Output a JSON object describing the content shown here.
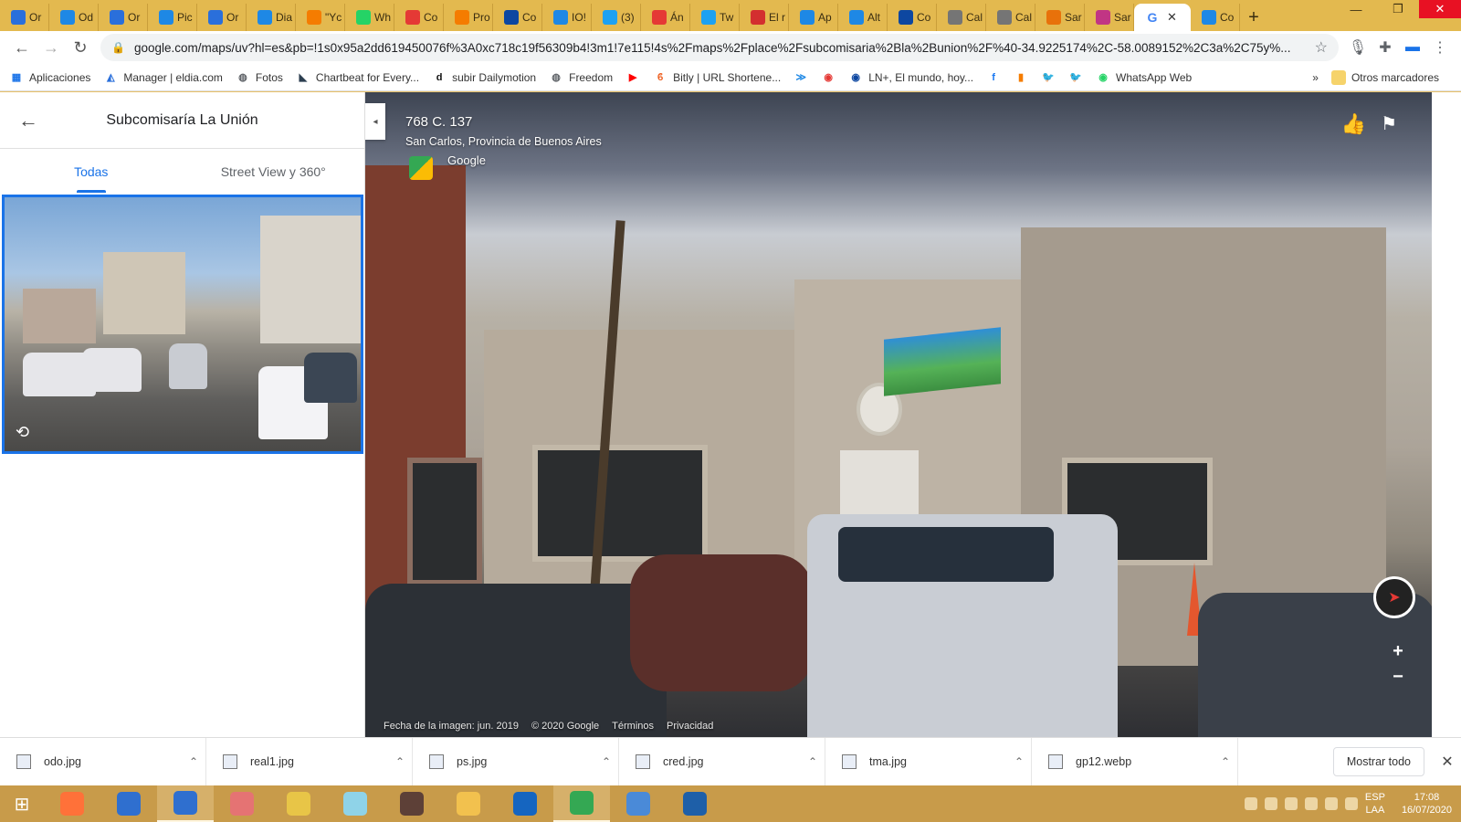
{
  "browser": {
    "tabs": [
      {
        "label": "Or",
        "icon": "eldia-icon",
        "color": "#2a6fdb"
      },
      {
        "label": "Od",
        "icon": "ms-icon",
        "color": "#1e88e5"
      },
      {
        "label": "Or",
        "icon": "eldia-icon",
        "color": "#2a6fdb"
      },
      {
        "label": "Pic",
        "icon": "ms-icon",
        "color": "#1e88e5"
      },
      {
        "label": "Or",
        "icon": "eldia-icon",
        "color": "#2a6fdb"
      },
      {
        "label": "Dia",
        "icon": "ms-icon",
        "color": "#1e88e5"
      },
      {
        "label": "\"Yc",
        "icon": "bookmark-icon",
        "color": "#f57c00"
      },
      {
        "label": "Wh",
        "icon": "whatsapp-icon",
        "color": "#25d366"
      },
      {
        "label": "Co",
        "icon": "red-icon",
        "color": "#e53935"
      },
      {
        "label": "Pro",
        "icon": "bookmark-icon",
        "color": "#f57c00"
      },
      {
        "label": "Co",
        "icon": "ln-icon",
        "color": "#0d47a1"
      },
      {
        "label": "IO!",
        "icon": "ms-icon",
        "color": "#1e88e5"
      },
      {
        "label": "(3)",
        "icon": "twitter-icon",
        "color": "#1da1f2"
      },
      {
        "label": "Án",
        "icon": "red-icon",
        "color": "#e53935"
      },
      {
        "label": "Tw",
        "icon": "twitter-icon",
        "color": "#1da1f2"
      },
      {
        "label": "El r",
        "icon": "w-icon",
        "color": "#d32f2f"
      },
      {
        "label": "Ap",
        "icon": "ms-icon",
        "color": "#1e88e5"
      },
      {
        "label": "Alt",
        "icon": "ms-icon",
        "color": "#1e88e5"
      },
      {
        "label": "Co",
        "icon": "ln-icon",
        "color": "#0d47a1"
      },
      {
        "label": "Cal",
        "icon": "globe-icon",
        "color": "#757575"
      },
      {
        "label": "Cal",
        "icon": "globe-icon",
        "color": "#757575"
      },
      {
        "label": "Sar",
        "icon": "g-icon",
        "color": "#e8710a"
      },
      {
        "label": "Sar",
        "icon": "instagram-icon",
        "color": "#c13584"
      }
    ],
    "active_tab": {
      "label": "G",
      "close": "✕"
    },
    "after_tab": {
      "label": "Co",
      "icon": "ms-icon",
      "color": "#1e88e5"
    },
    "new_tab": "+",
    "window_controls": {
      "minimize": "—",
      "restore": "❐",
      "close": "✕"
    },
    "url": "google.com/maps/uv?hl=es&pb=!1s0x95a2dd619450076f%3A0xc718c19f56309b4!3m1!7e115!4s%2Fmaps%2Fplace%2Fsubcomisaria%2Bla%2Bunion%2F%40-34.9225174%2C-58.0089152%2C3a%2C75y%..."
  },
  "bookmarks": {
    "items": [
      {
        "label": "Aplicaciones",
        "icon": "apps-grid-icon",
        "glyph": "▦",
        "color": "#1a73e8"
      },
      {
        "label": "Manager | eldia.com",
        "icon": "eldia-icon",
        "glyph": "◭",
        "color": "#2a6fdb"
      },
      {
        "label": "Fotos",
        "icon": "globe-icon",
        "glyph": "◍",
        "color": "#5f6368"
      },
      {
        "label": "Chartbeat for Every...",
        "icon": "chartbeat-icon",
        "glyph": "◣",
        "color": "#2c3e50"
      },
      {
        "label": "subir Dailymotion",
        "icon": "dailymotion-icon",
        "glyph": "d",
        "color": "#111"
      },
      {
        "label": "Freedom",
        "icon": "globe-icon",
        "glyph": "◍",
        "color": "#5f6368"
      },
      {
        "label": "",
        "icon": "youtube-icon",
        "glyph": "▶",
        "color": "#ff0000"
      },
      {
        "label": "Bitly | URL Shortene...",
        "icon": "bitly-icon",
        "glyph": "ϐ",
        "color": "#ee6123"
      },
      {
        "label": "",
        "icon": "ms-icon",
        "glyph": "≫",
        "color": "#1e88e5"
      },
      {
        "label": "",
        "icon": "red-icon",
        "glyph": "◉",
        "color": "#e53935"
      },
      {
        "label": "LN+, El mundo, hoy...",
        "icon": "ln-icon",
        "glyph": "◉",
        "color": "#0d47a1"
      },
      {
        "label": "",
        "icon": "facebook-icon",
        "glyph": "f",
        "color": "#1877f2"
      },
      {
        "label": "",
        "icon": "bookmark-icon",
        "glyph": "▮",
        "color": "#f57c00"
      },
      {
        "label": "",
        "icon": "twitter-icon",
        "glyph": "🐦",
        "color": "#1da1f2"
      },
      {
        "label": "",
        "icon": "twitter-icon",
        "glyph": "🐦",
        "color": "#1da1f2"
      },
      {
        "label": "WhatsApp Web",
        "icon": "whatsapp-icon",
        "glyph": "◉",
        "color": "#25d366"
      }
    ],
    "overflow": "»",
    "other": "Otros marcadores"
  },
  "maps": {
    "place_title": "Subcomisaría La Unión",
    "tabs": [
      {
        "label": "Todas",
        "active": true
      },
      {
        "label": "Street View y 360°",
        "active": false
      }
    ],
    "collapse_glyph": "◂"
  },
  "street_view": {
    "address_line1": "768 C. 137",
    "address_line2": "San Carlos, Provincia de Buenos Aires",
    "provider": "Google",
    "footer": {
      "image_date": "Fecha de la imagen: jun. 2019",
      "copyright": "© 2020 Google",
      "terms": "Términos",
      "privacy": "Privacidad"
    },
    "zoom_in": "+",
    "zoom_out": "−"
  },
  "downloads": {
    "files": [
      {
        "name": "odo.jpg"
      },
      {
        "name": "real1.jpg"
      },
      {
        "name": "ps.jpg"
      },
      {
        "name": "cred.jpg"
      },
      {
        "name": "tma.jpg"
      },
      {
        "name": "gp12.webp"
      }
    ],
    "show_all": "Mostrar todo",
    "close": "✕"
  },
  "taskbar": {
    "apps": [
      {
        "icon": "firefox-icon",
        "color": "#ff7139",
        "active": false
      },
      {
        "icon": "mail-app-icon",
        "color": "#2f6fcf",
        "active": false
      },
      {
        "icon": "mail-app-icon",
        "color": "#2f6fcf",
        "active": true
      },
      {
        "icon": "paint-icon",
        "color": "#e57373",
        "active": false
      },
      {
        "icon": "folder-app-icon",
        "color": "#e8c547",
        "active": false
      },
      {
        "icon": "notepad-icon",
        "color": "#8fd3e8",
        "active": false
      },
      {
        "icon": "video-icon",
        "color": "#5d4037",
        "active": false
      },
      {
        "icon": "explorer-icon",
        "color": "#f2c14e",
        "active": false
      },
      {
        "icon": "editor-icon",
        "color": "#1565c0",
        "active": false
      },
      {
        "icon": "chrome-icon",
        "color": "#34a853",
        "active": true
      },
      {
        "icon": "photos-icon",
        "color": "#4a8ad8",
        "active": false
      },
      {
        "icon": "document-icon",
        "color": "#1e5fa8",
        "active": false
      }
    ],
    "lang_top": "ESP",
    "lang_bottom": "LAA",
    "time": "17:08",
    "date": "16/07/2020"
  }
}
